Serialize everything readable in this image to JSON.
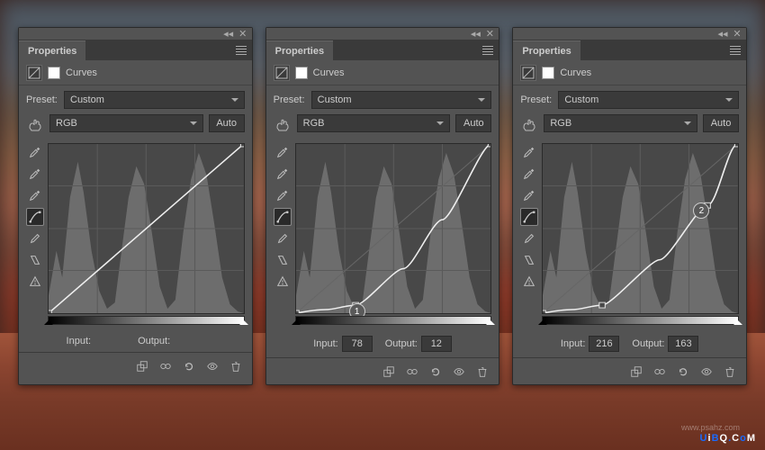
{
  "panels": [
    {
      "title": "Properties",
      "section": "Curves",
      "preset_label": "Preset:",
      "preset_value": "Custom",
      "channel": "RGB",
      "auto": "Auto",
      "input_label": "Input:",
      "output_label": "Output:",
      "input_value": "",
      "output_value": "",
      "marker": null,
      "curve_points": [
        [
          0,
          190
        ],
        [
          200,
          0
        ]
      ],
      "anchors": []
    },
    {
      "title": "Properties",
      "section": "Curves",
      "preset_label": "Preset:",
      "preset_value": "Custom",
      "channel": "RGB",
      "auto": "Auto",
      "input_label": "Input:",
      "output_label": "Output:",
      "input_value": "78",
      "output_value": "12",
      "marker": "1",
      "curve_points": [
        [
          0,
          190
        ],
        [
          30,
          186
        ],
        [
          61,
          181
        ],
        [
          110,
          140
        ],
        [
          150,
          85
        ],
        [
          200,
          0
        ]
      ],
      "anchors": [
        [
          61,
          181
        ]
      ]
    },
    {
      "title": "Properties",
      "section": "Curves",
      "preset_label": "Preset:",
      "preset_value": "Custom",
      "channel": "RGB",
      "auto": "Auto",
      "input_label": "Input:",
      "output_label": "Output:",
      "input_value": "216",
      "output_value": "163",
      "marker": "2",
      "curve_points": [
        [
          0,
          190
        ],
        [
          30,
          186
        ],
        [
          61,
          181
        ],
        [
          120,
          130
        ],
        [
          169,
          69
        ],
        [
          200,
          0
        ]
      ],
      "anchors": [
        [
          61,
          181
        ],
        [
          169,
          69
        ]
      ]
    }
  ],
  "watermark": "UiBQ.CoM",
  "watermark2": "www.psahz.com",
  "chart_data": [
    {
      "type": "line",
      "title": "Curves (RGB)",
      "xlabel": "Input",
      "ylabel": "Output",
      "xlim": [
        0,
        255
      ],
      "ylim": [
        0,
        255
      ],
      "series": [
        {
          "name": "curve",
          "x": [
            0,
            255
          ],
          "y": [
            0,
            255
          ]
        }
      ]
    },
    {
      "type": "line",
      "title": "Curves (RGB)",
      "xlabel": "Input",
      "ylabel": "Output",
      "xlim": [
        0,
        255
      ],
      "ylim": [
        0,
        255
      ],
      "series": [
        {
          "name": "curve",
          "x": [
            0,
            78,
            255
          ],
          "y": [
            0,
            12,
            255
          ]
        }
      ],
      "selected_point": {
        "input": 78,
        "output": 12
      }
    },
    {
      "type": "line",
      "title": "Curves (RGB)",
      "xlabel": "Input",
      "ylabel": "Output",
      "xlim": [
        0,
        255
      ],
      "ylim": [
        0,
        255
      ],
      "series": [
        {
          "name": "curve",
          "x": [
            0,
            78,
            216,
            255
          ],
          "y": [
            0,
            12,
            163,
            255
          ]
        }
      ],
      "selected_point": {
        "input": 216,
        "output": 163
      }
    }
  ]
}
